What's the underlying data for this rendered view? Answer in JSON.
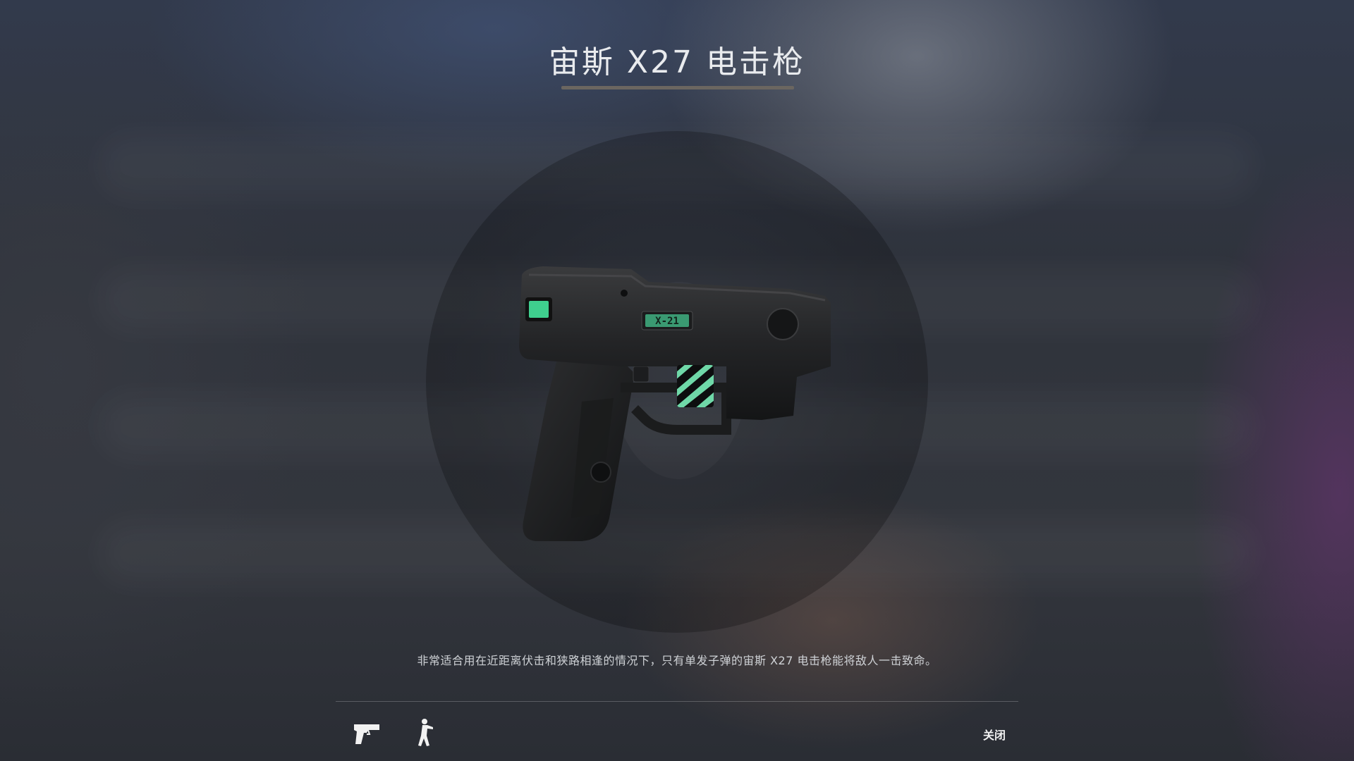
{
  "dialog": {
    "title": "宙斯 X27 电击枪",
    "description": "非常适合用在近距离伏击和狭路相逢的情况下，只有单发子弹的宙斯 X27 电击枪能将敌人一击致命。",
    "weapon_marking": "X-21",
    "close_label": "关闭"
  },
  "footer": {
    "icons": [
      "pistol-icon",
      "soldier-icon"
    ]
  },
  "colors": {
    "accent_green": "#3fcf8e",
    "title_underline": "#6b6660"
  }
}
